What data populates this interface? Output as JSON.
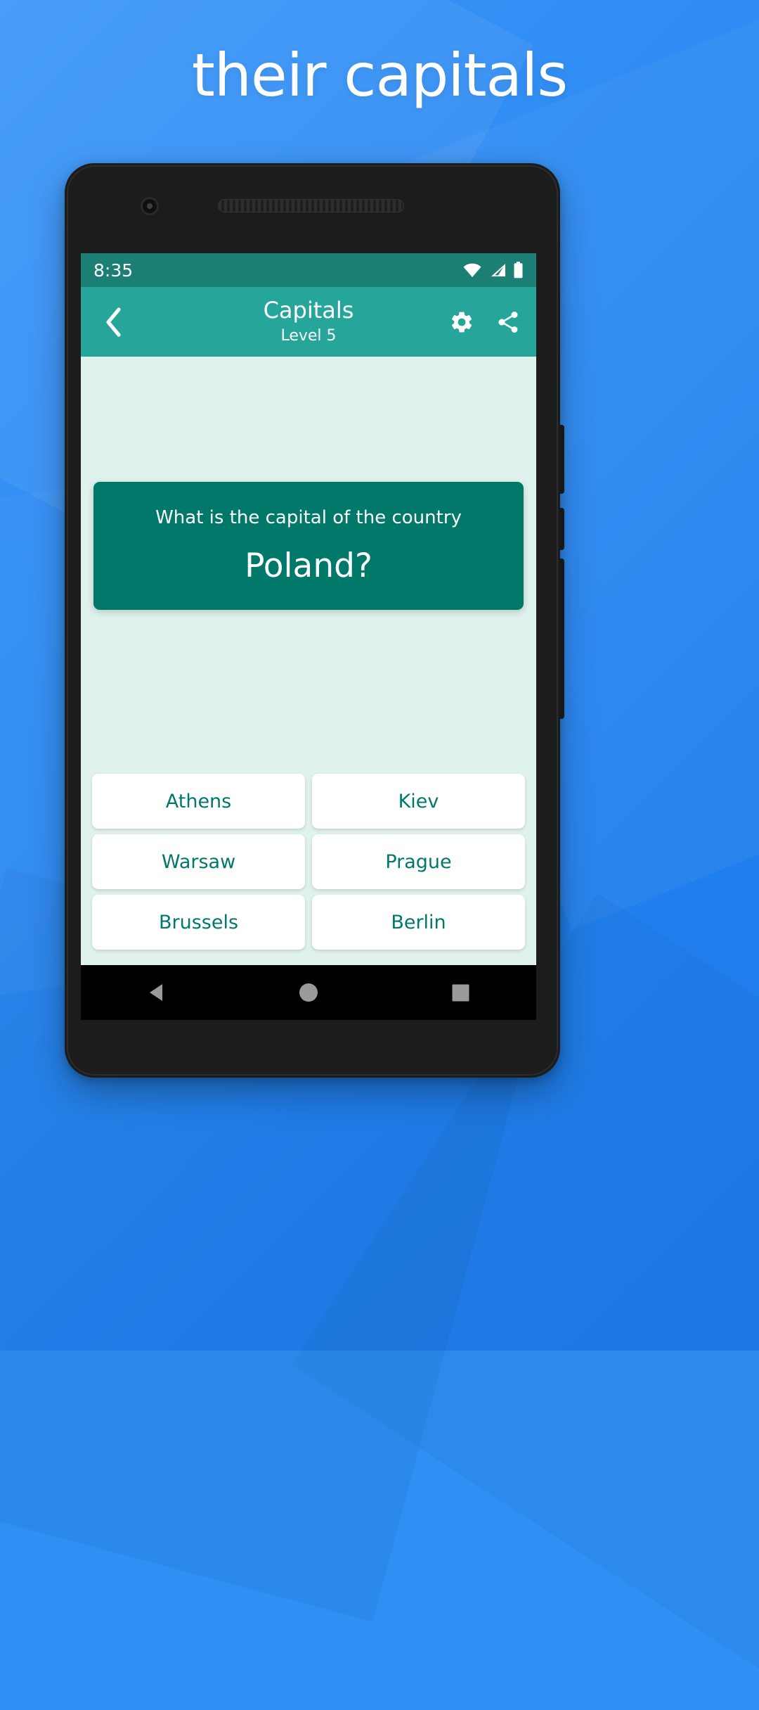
{
  "promo": {
    "headline": "their capitals",
    "background_color": "#2E8FF5"
  },
  "phone": {
    "status_bar": {
      "time": "8:35",
      "background_color": "#1B7F76",
      "icons": [
        "wifi-icon",
        "signal-icon",
        "battery-icon"
      ]
    },
    "app_bar": {
      "background_color": "#26A69A",
      "back_icon": "chevron-left-icon",
      "title": "Capitals",
      "subtitle": "Level 5",
      "actions": [
        "gear-icon",
        "share-icon"
      ]
    },
    "quiz": {
      "background_color": "#E0F2EE",
      "card_color": "#00796B",
      "accent_color": "#00796B",
      "prompt": "What is the capital of the country",
      "subject": "Poland?",
      "answers": [
        {
          "label": "Athens"
        },
        {
          "label": "Kiev"
        },
        {
          "label": "Warsaw"
        },
        {
          "label": "Prague"
        },
        {
          "label": "Brussels"
        },
        {
          "label": "Berlin"
        }
      ]
    },
    "nav_bar": {
      "background_color": "#000000",
      "buttons": [
        "back-triangle-icon",
        "home-circle-icon",
        "recents-square-icon"
      ]
    }
  }
}
